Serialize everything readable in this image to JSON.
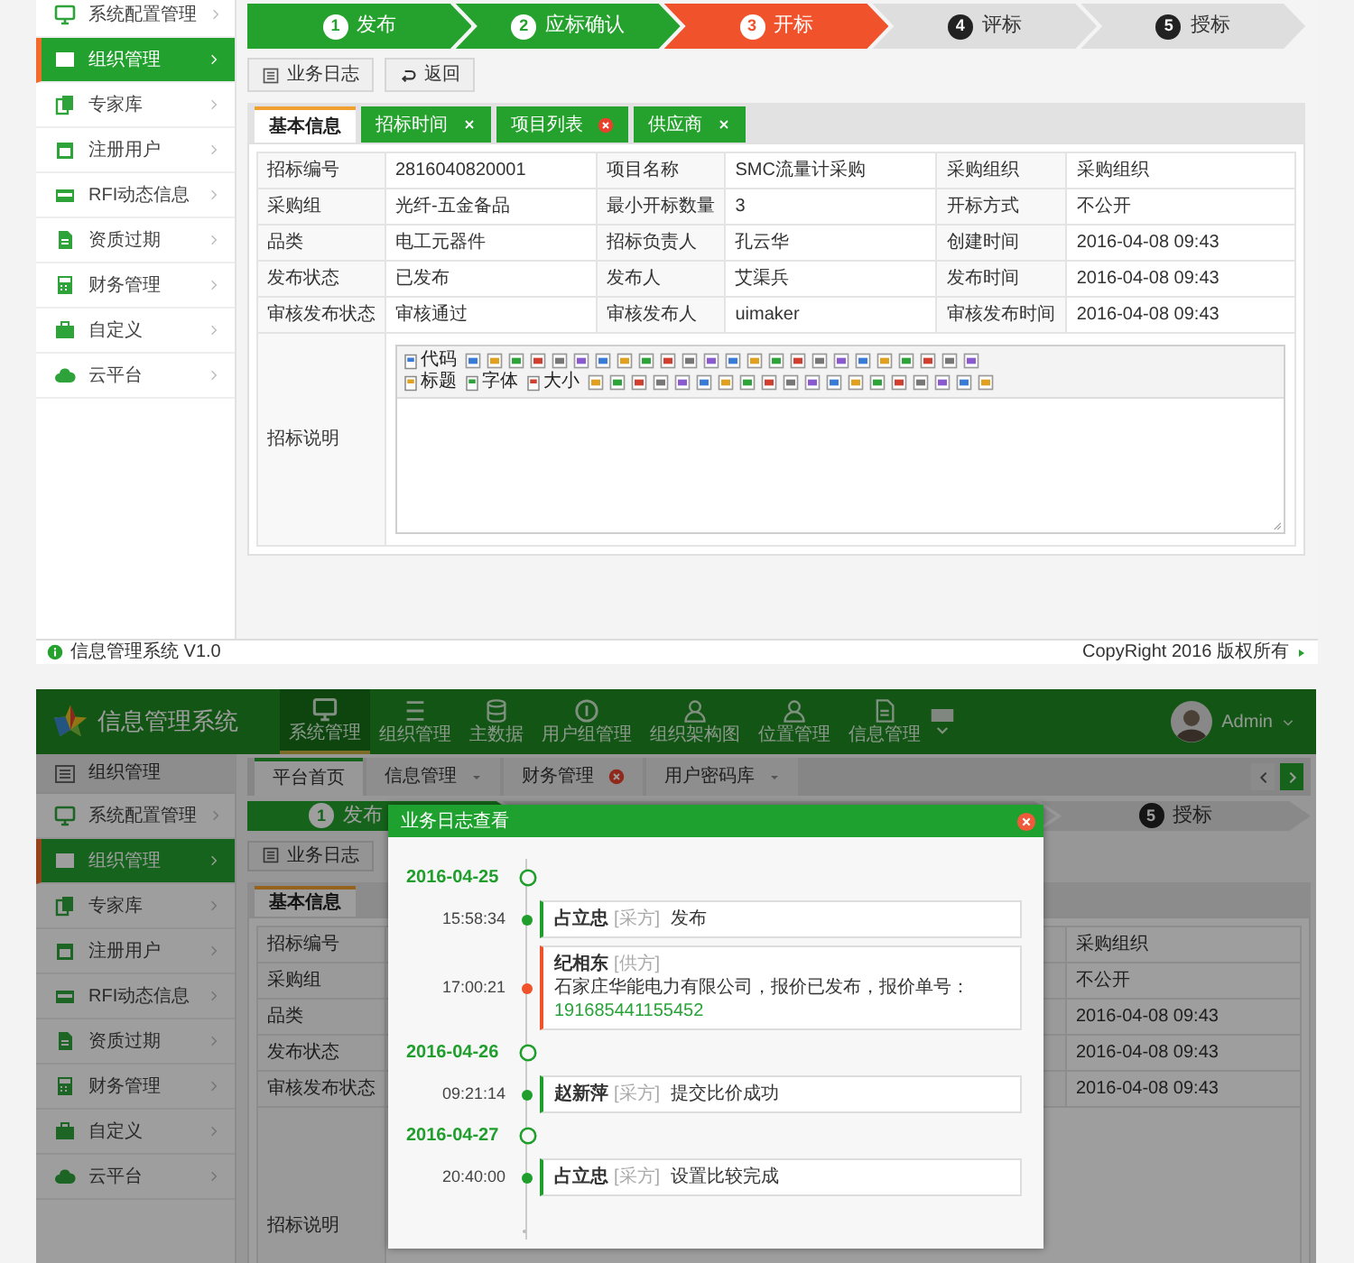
{
  "panel_a": {
    "sidebar": {
      "items": [
        {
          "label": "系统配置管理",
          "selected": false
        },
        {
          "label": "组织管理",
          "selected": true
        },
        {
          "label": "专家库",
          "selected": false
        },
        {
          "label": "注册用户",
          "selected": false
        },
        {
          "label": "RFI动态信息",
          "selected": false
        },
        {
          "label": "资质过期",
          "selected": false
        },
        {
          "label": "财务管理",
          "selected": false
        },
        {
          "label": "自定义",
          "selected": false
        },
        {
          "label": "云平台",
          "selected": false
        }
      ]
    },
    "steps": [
      {
        "number": "1",
        "label": "发布",
        "completed": true,
        "current": false
      },
      {
        "number": "2",
        "label": "应标确认",
        "completed": true,
        "current": false
      },
      {
        "number": "3",
        "label": "开标",
        "completed": false,
        "current": true
      },
      {
        "number": "4",
        "label": "评标",
        "completed": false,
        "current": false
      },
      {
        "number": "5",
        "label": "授标",
        "completed": false,
        "current": false
      }
    ],
    "buttons": [
      {
        "label": "业务日志",
        "kind": "log"
      },
      {
        "label": "返回",
        "kind": "back"
      }
    ],
    "tabs": [
      {
        "label": "基本信息",
        "selected": true,
        "kind": "plain"
      },
      {
        "label": "招标时间",
        "selected": false,
        "kind": "closable"
      },
      {
        "label": "项目列表",
        "selected": false,
        "kind": "alert"
      },
      {
        "label": "供应商",
        "selected": false,
        "kind": "closable"
      }
    ],
    "table": {
      "rows": [
        [
          "招标编号",
          "2816040820001",
          "项目名称",
          "SMC流量计采购",
          "采购组织",
          "采购组织"
        ],
        [
          "采购组",
          "光纤-五金备品",
          "最小开标数量",
          "3",
          "开标方式",
          "不公开"
        ],
        [
          "品类",
          "电工元器件",
          "招标负责人",
          "孔云华",
          "创建时间",
          "2016-04-08 09:43"
        ],
        [
          "发布状态",
          "已发布",
          "发布人",
          "艾渠兵",
          "发布时间",
          "2016-04-08 09:43"
        ],
        [
          "审核发布状态",
          "审核通过",
          "审核发布人",
          "uimaker",
          "审核发布时间",
          "2016-04-08 09:43"
        ]
      ]
    },
    "editor": {
      "label": "招标说明",
      "toolbar": [
        [
          "代码"
        ],
        [
          "标题",
          "字体",
          "大小"
        ]
      ]
    },
    "footer": {
      "left": "信息管理系统 V1.0",
      "right": "CopyRight 2016 版权所有"
    }
  },
  "panel_b": {
    "header": {
      "title": "信息管理系统",
      "nav": [
        {
          "label": "系统管理",
          "selected": true
        },
        {
          "label": "组织管理",
          "selected": false
        },
        {
          "label": "主数据",
          "selected": false
        },
        {
          "label": "用户组管理",
          "selected": false
        },
        {
          "label": "组织架构图",
          "selected": false
        },
        {
          "label": "位置管理",
          "selected": false
        },
        {
          "label": "信息管理",
          "selected": false
        }
      ],
      "user": "Admin"
    },
    "sidebar": {
      "title": "组织管理",
      "items": [
        {
          "label": "系统配置管理",
          "selected": false
        },
        {
          "label": "组织管理",
          "selected": true
        },
        {
          "label": "专家库",
          "selected": false
        },
        {
          "label": "注册用户",
          "selected": false
        },
        {
          "label": "RFI动态信息",
          "selected": false
        },
        {
          "label": "资质过期",
          "selected": false
        },
        {
          "label": "财务管理",
          "selected": false
        },
        {
          "label": "自定义",
          "selected": false
        },
        {
          "label": "云平台",
          "selected": false
        }
      ]
    },
    "page_tabs": [
      {
        "label": "平台首页",
        "selected": true,
        "kind": "plain"
      },
      {
        "label": "信息管理",
        "selected": false,
        "kind": "dropdown"
      },
      {
        "label": "财务管理",
        "selected": false,
        "kind": "alert"
      },
      {
        "label": "用户密码库",
        "selected": false,
        "kind": "dropdown"
      }
    ],
    "steps": [
      {
        "number": "1",
        "label": "发布",
        "completed": true,
        "current": false
      },
      {
        "number": "5",
        "label": "授标",
        "completed": false,
        "current": false
      }
    ],
    "buttons": [
      {
        "label": "业务日志",
        "kind": "log"
      }
    ],
    "tabs": [
      {
        "label": "基本信息",
        "selected": true
      }
    ],
    "table": {
      "labels": [
        "招标编号",
        "采购组",
        "品类",
        "发布状态",
        "审核发布状态"
      ],
      "values": [
        "采购组织",
        "不公开",
        "2016-04-08 09:43",
        "2016-04-08 09:43",
        "2016-04-08 09:43"
      ]
    },
    "editor_label": "招标说明",
    "dialog": {
      "title": "业务日志查看",
      "days": [
        {
          "date": "2016-04-25",
          "entries": [
            {
              "time": "15:58:34",
              "name": "占立忠",
              "role": "[采方]",
              "message": "发布",
              "color": "#1f9e2c"
            },
            {
              "time": "17:00:21",
              "name": "纪相东",
              "role": "[供方]",
              "message": "石家庄华能电力有限公司，报价已发布，报价单号：",
              "order_no": "191685441155452",
              "color": "#f0522a"
            }
          ]
        },
        {
          "date": "2016-04-26",
          "entries": [
            {
              "time": "09:21:14",
              "name": "赵新萍",
              "role": "[采方]",
              "message": "提交比价成功",
              "color": "#1f9e2c"
            }
          ]
        },
        {
          "date": "2016-04-27",
          "entries": [
            {
              "time": "20:40:00",
              "name": "占立忠",
              "role": "[采方]",
              "message": "设置比较完成",
              "color": "#1f9e2c"
            }
          ]
        }
      ]
    }
  }
}
